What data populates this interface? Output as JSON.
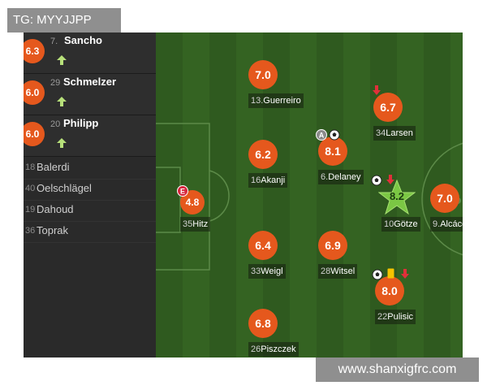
{
  "watermarks": {
    "tg": "TG: MYYJJPP",
    "site": "www.shanxigfrc.com"
  },
  "colors": {
    "rating_bg": "#e5581d",
    "star_fill": "#7bc744",
    "pitch_dark": "#2f5a1f",
    "pitch_light": "#346322",
    "sub_in_arrow": "#b7e07a",
    "sub_out_arrow": "#e0303a",
    "yellow_card": "#f5c400"
  },
  "substitutes": [
    {
      "number": "7.",
      "name": "Sancho",
      "rating": "6.3",
      "icon": "sub-in-arrow-icon"
    },
    {
      "number": "29",
      "name": "Schmelzer",
      "rating": "6.0",
      "icon": "sub-in-arrow-icon"
    },
    {
      "number": "20",
      "name": "Philipp",
      "rating": "6.0",
      "icon": "sub-in-arrow-icon"
    }
  ],
  "bench": [
    {
      "number": "18",
      "name": "Balerdi"
    },
    {
      "number": "40",
      "name": "Oelschlägel"
    },
    {
      "number": "19",
      "name": "Dahoud"
    },
    {
      "number": "36",
      "name": "Toprak"
    }
  ],
  "players": [
    {
      "number": "35",
      "name": "Hitz",
      "rating": "4.8"
    },
    {
      "number": "13.",
      "name": "Guerreiro",
      "rating": "7.0"
    },
    {
      "number": "16",
      "name": "Akanji",
      "rating": "6.2"
    },
    {
      "number": "33",
      "name": "Weigl",
      "rating": "6.4"
    },
    {
      "number": "26",
      "name": "Piszczek",
      "rating": "6.8"
    },
    {
      "number": "6.",
      "name": "Delaney",
      "rating": "8.1"
    },
    {
      "number": "28",
      "name": "Witsel",
      "rating": "6.9"
    },
    {
      "number": "34",
      "name": "Larsen",
      "rating": "6.7"
    },
    {
      "number": "10",
      "name": "Götze",
      "rating": "8.2",
      "man_of_match": true
    },
    {
      "number": "22",
      "name": "Pulisic",
      "rating": "8.0"
    },
    {
      "number": "9.",
      "name": "Alcácer",
      "rating": "7.0"
    }
  ],
  "badges": {
    "error_badge": "E",
    "assist_badge": "A"
  }
}
